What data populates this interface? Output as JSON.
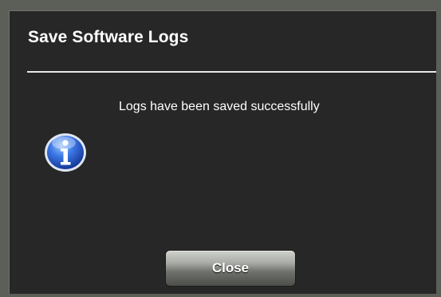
{
  "dialog": {
    "title": "Save Software Logs",
    "message": "Logs have been saved successfully",
    "icon": "info-icon",
    "close_label": "Close"
  },
  "colors": {
    "frame": "#5c5e58",
    "dialog_background": "#272727",
    "text": "#ffffff",
    "icon_blue": "#2f5fd0"
  }
}
